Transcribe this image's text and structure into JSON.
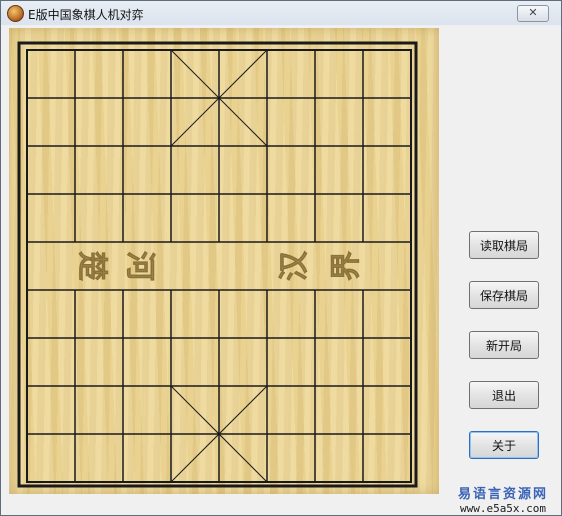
{
  "window": {
    "title": "E版中国象棋人机对弈",
    "close_label": "✕"
  },
  "board": {
    "columns": 9,
    "rows": 10,
    "river_text": [
      "楚",
      "河",
      "汉",
      "界"
    ],
    "colors": {
      "wood": "#ecd593",
      "line": "#1a1a1a",
      "river_text": "#a48a4e"
    }
  },
  "buttons": {
    "load_label": "读取棋局",
    "save_label": "保存棋局",
    "new_label": "新开局",
    "exit_label": "退出",
    "about_label": "关于"
  },
  "watermark": {
    "site_name": "易语言资源网",
    "url": "www.e5a5x.com"
  }
}
